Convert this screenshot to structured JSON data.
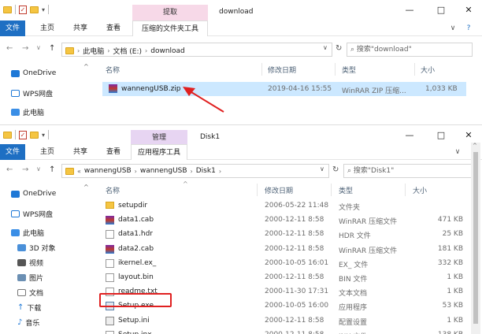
{
  "top_window": {
    "title": "download",
    "ribbon_context": "提取",
    "ribbon_tabs": [
      "文件",
      "主页",
      "共享",
      "查看"
    ],
    "ribbon_tool": "压缩的文件夹工具",
    "path": [
      "此电脑",
      "文档 (E:)",
      "download"
    ],
    "search_placeholder": "搜索\"download\"",
    "columns": [
      "名称",
      "修改日期",
      "类型",
      "大小"
    ],
    "nav": [
      "OneDrive",
      "WPS网盘",
      "此电脑"
    ],
    "files": [
      {
        "name": "wannengUSB.zip",
        "date": "2019-04-16 15:55",
        "type": "WinRAR ZIP 压缩...",
        "size": "1,033 KB"
      }
    ]
  },
  "bottom_window": {
    "title": "Disk1",
    "ribbon_context": "管理",
    "ribbon_tabs": [
      "文件",
      "主页",
      "共享",
      "查看"
    ],
    "ribbon_tool": "应用程序工具",
    "path_overflow": "«",
    "path": [
      "wannengUSB",
      "wannengUSB",
      "Disk1"
    ],
    "search_placeholder": "搜索\"Disk1\"",
    "columns": [
      "名称",
      "修改日期",
      "类型",
      "大小"
    ],
    "nav": [
      "OneDrive",
      "WPS网盘",
      "此电脑",
      "3D 对象",
      "视频",
      "图片",
      "文档",
      "下载",
      "音乐"
    ],
    "files": [
      {
        "name": "setupdir",
        "date": "2006-05-22 11:48",
        "type": "文件夹",
        "size": "",
        "icon": "folder"
      },
      {
        "name": "data1.cab",
        "date": "2000-12-11 8:58",
        "type": "WinRAR 压缩文件",
        "size": "471 KB",
        "icon": "archive"
      },
      {
        "name": "data1.hdr",
        "date": "2000-12-11 8:58",
        "type": "HDR 文件",
        "size": "25 KB",
        "icon": "doc"
      },
      {
        "name": "data2.cab",
        "date": "2000-12-11 8:58",
        "type": "WinRAR 压缩文件",
        "size": "181 KB",
        "icon": "archive"
      },
      {
        "name": "ikernel.ex_",
        "date": "2000-10-05 16:01",
        "type": "EX_ 文件",
        "size": "332 KB",
        "icon": "doc"
      },
      {
        "name": "layout.bin",
        "date": "2000-12-11 8:58",
        "type": "BIN 文件",
        "size": "1 KB",
        "icon": "doc"
      },
      {
        "name": "readme.txt",
        "date": "2000-11-30 17:31",
        "type": "文本文档",
        "size": "1 KB",
        "icon": "doc"
      },
      {
        "name": "Setup.exe",
        "date": "2000-10-05 16:00",
        "type": "应用程序",
        "size": "53 KB",
        "icon": "exe"
      },
      {
        "name": "Setup.ini",
        "date": "2000-12-11 8:58",
        "type": "配置设置",
        "size": "1 KB",
        "icon": "ini"
      },
      {
        "name": "Setup.inx",
        "date": "2000-12-11 8:58",
        "type": "INX 文件",
        "size": "138 KB",
        "icon": "doc"
      }
    ]
  },
  "window_controls": {
    "minimize": "—",
    "maximize": "□",
    "close": "✕",
    "help": "?",
    "collapse": "∨"
  },
  "icons": {
    "back": "←",
    "forward": "→",
    "dropdown": "∨",
    "up": "↑",
    "refresh": "↻",
    "search": "⌕",
    "chevron": "›",
    "sort": "^"
  },
  "colors": {
    "file_tab": "#1e6fc3",
    "extract_tab": "#f7d9e8",
    "manage_tab": "#e7d5f2",
    "selection": "#cce8ff",
    "highlight": "#e02020"
  }
}
